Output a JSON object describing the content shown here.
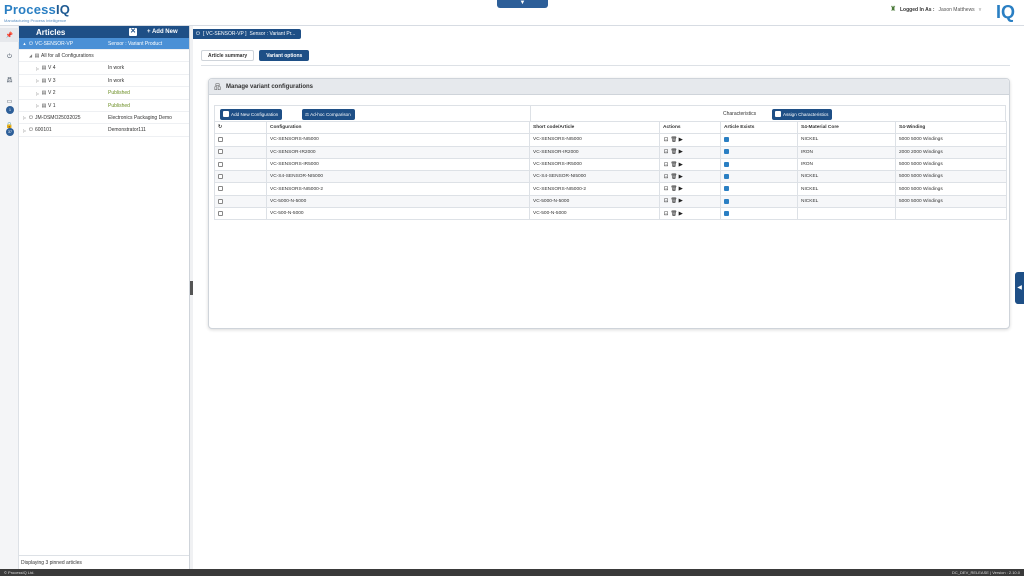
{
  "header": {
    "logo_process": "Process",
    "logo_iq": "IQ",
    "logo_subtitle": "Manufacturing Process Intelligence",
    "logged_label": "Logged In As :",
    "user_name": "Jason Matthews",
    "brand_mark": "IQ",
    "dropdown_glyph": "▼"
  },
  "articles": {
    "title": "Articles",
    "close_glyph": "✕",
    "add_new": "+ Add New",
    "rows": [
      {
        "caret": "▲",
        "icon": "⏻",
        "name": "VC-SENSOR-VP",
        "desc": "Sensor : Variant Product",
        "selected": true
      },
      {
        "caret": "◢",
        "icon": "▤",
        "name": "All for all Configurations",
        "desc": ""
      },
      {
        "caret": "▷",
        "icon": "▤",
        "name": "V 4",
        "desc": "In work",
        "status": "work"
      },
      {
        "caret": "▷",
        "icon": "▤",
        "name": "V 3",
        "desc": "In work",
        "status": "work"
      },
      {
        "caret": "▷",
        "icon": "▤",
        "name": "V 2",
        "desc": "Published",
        "status": "pub"
      },
      {
        "caret": "▷",
        "icon": "▤",
        "name": "V 1",
        "desc": "Published",
        "status": "pub"
      },
      {
        "caret": "▷",
        "icon": "⏻",
        "name": "JM-DSMO25032025",
        "desc": "Electronics Packaging Demo"
      },
      {
        "caret": "▷",
        "icon": "⏻",
        "name": "600101",
        "desc": "Demonstrator111"
      }
    ],
    "footer": "Displaying 3 pinned articles"
  },
  "rail": {
    "badge_1": "1",
    "badge_2": "37"
  },
  "main": {
    "breadcrumb_code": "[ VC-SENSOR-VP ]",
    "breadcrumb_desc": "Sensor : Variant Pr...",
    "tabs": [
      "Article summary",
      "Variant options"
    ],
    "card_title": "Manage variant configurations",
    "btn_add_config": "Add New Configuration",
    "btn_adhoc": "Ad-hoc Comparison",
    "characteristics_label": "Characteristics",
    "btn_assign": "Assign Characteristics",
    "columns": [
      "",
      "Configuration",
      "Short code/Article",
      "Actions",
      "Article Exists",
      "S4-Material Core",
      "S4-Winding"
    ],
    "rows": [
      {
        "configuration": "VC-SENSORS-NI5000",
        "short_code": "VC-SENSORS-NI5000",
        "exists": true,
        "core": "NICKEL",
        "winding": "5000 5000 Windings"
      },
      {
        "configuration": "VC-SENSOR-IR2000",
        "short_code": "VC-SENSOR-IR2000",
        "exists": true,
        "core": "IRON",
        "winding": "2000 2000 Windings"
      },
      {
        "configuration": "VC-SENSORS-IR5000",
        "short_code": "VC-SENSORS-IR5000",
        "exists": true,
        "core": "IRON",
        "winding": "5000 5000 Windings"
      },
      {
        "configuration": "VC-S4-SENSOR-NI5000",
        "short_code": "VC-S4-SENSOR-NI5000",
        "exists": true,
        "core": "NICKEL",
        "winding": "5000 5000 Windings"
      },
      {
        "configuration": "VC-SENSORS-NI5000-2",
        "short_code": "VC-SENSORS-NI5000-2",
        "exists": true,
        "core": "NICKEL",
        "winding": "5000 5000 Windings"
      },
      {
        "configuration": "VC-5000-N-5000",
        "short_code": "VC-5000-N-5000",
        "exists": true,
        "core": "NICKEL",
        "winding": "5000 5000 Windings"
      },
      {
        "configuration": "VC-500-N-5000",
        "short_code": "VC-500-N-5000",
        "exists": true,
        "core": "",
        "winding": ""
      }
    ]
  },
  "footer": {
    "left": "© ProcessIQ Ltd.",
    "right": "DC_DEV_RELEASE | Version : 2.10.0"
  },
  "colors": {
    "primary": "#1e4f86",
    "accent": "#2a7fc3",
    "selected": "#4a90d6",
    "published": "#6b8e23"
  }
}
